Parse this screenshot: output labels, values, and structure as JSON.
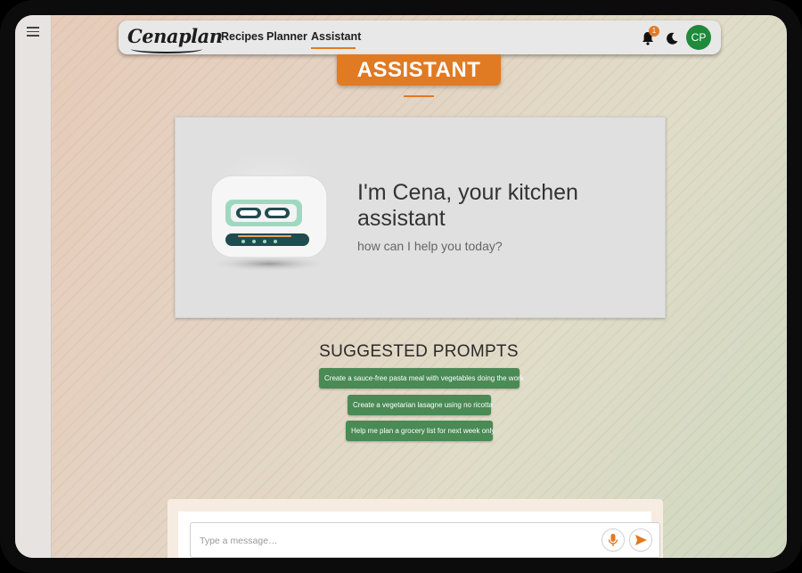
{
  "app": {
    "logo": "Cenaplan"
  },
  "nav": {
    "links": [
      {
        "label": "Recipes"
      },
      {
        "label": "Planner"
      },
      {
        "label": "Assistant"
      }
    ],
    "notification_count": "1",
    "avatar_initials": "CP"
  },
  "page": {
    "title": "ASSISTANT"
  },
  "hero": {
    "title": "I'm Cena, your kitchen assistant",
    "subtitle": "how can I help you today?"
  },
  "suggested": {
    "title": "SUGGESTED PROMPTS",
    "prompts": [
      "Create a sauce-free pasta meal with vegetables doing the work",
      "Create a vegetarian lasagne using no ricotta",
      "Help me plan a grocery list for next week only"
    ]
  },
  "composer": {
    "placeholder": "Type a message…"
  },
  "colors": {
    "accent": "#e07a23",
    "prompt_green": "#4a8a55",
    "avatar_green": "#1e8a3a"
  }
}
